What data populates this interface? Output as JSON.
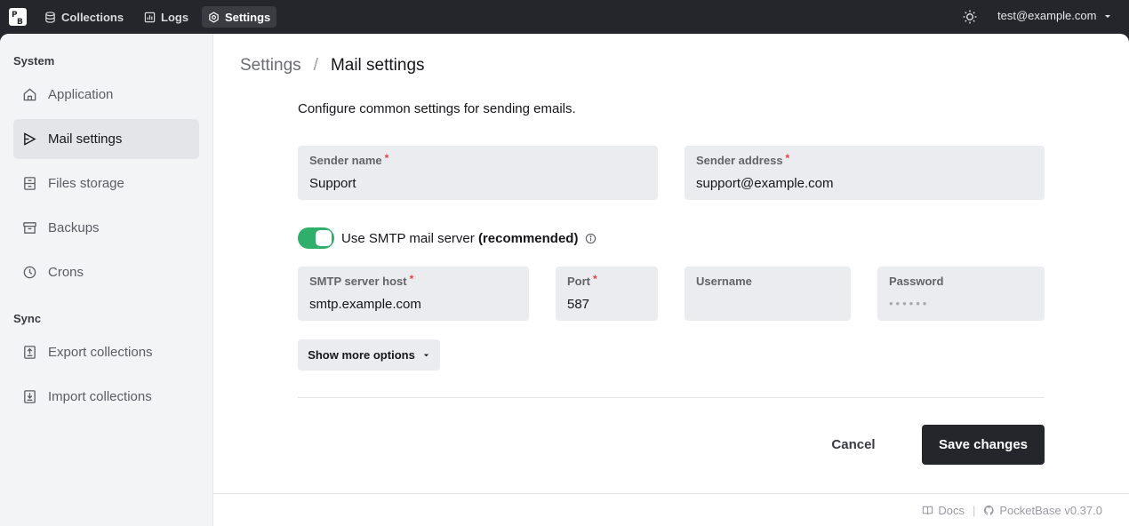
{
  "topbar": {
    "nav": [
      {
        "label": "Collections",
        "icon": "database-icon"
      },
      {
        "label": "Logs",
        "icon": "chart-icon"
      },
      {
        "label": "Settings",
        "icon": "gear-icon",
        "active": true
      }
    ],
    "user_email": "test@example.com"
  },
  "sidebar": {
    "system_title": "System",
    "sync_title": "Sync",
    "items": [
      {
        "label": "Application",
        "icon": "home-icon"
      },
      {
        "label": "Mail settings",
        "icon": "send-icon",
        "active": true
      },
      {
        "label": "Files storage",
        "icon": "storage-icon"
      },
      {
        "label": "Backups",
        "icon": "archive-icon"
      },
      {
        "label": "Crons",
        "icon": "clock-icon"
      },
      {
        "label": "Export collections",
        "icon": "export-icon"
      },
      {
        "label": "Import collections",
        "icon": "import-icon"
      }
    ]
  },
  "breadcrumb": {
    "root": "Settings",
    "separator": "/",
    "current": "Mail settings"
  },
  "intro": "Configure common settings for sending emails.",
  "fields": {
    "sender_name": {
      "label": "Sender name",
      "required": "*",
      "value": "Support"
    },
    "sender_address": {
      "label": "Sender address",
      "required": "*",
      "value": "support@example.com"
    },
    "smtp_host": {
      "label": "SMTP server host",
      "required": "*",
      "value": "smtp.example.com"
    },
    "port": {
      "label": "Port",
      "required": "*",
      "value": "587"
    },
    "username": {
      "label": "Username",
      "value": ""
    },
    "password": {
      "label": "Password",
      "placeholder": "••••••"
    }
  },
  "smtp_toggle": {
    "label": "Use SMTP mail server",
    "emphasis": "(recommended)",
    "enabled": true
  },
  "buttons": {
    "show_more": "Show more options",
    "cancel": "Cancel",
    "save": "Save changes"
  },
  "footer": {
    "docs": "Docs",
    "version": "PocketBase v0.37.0"
  },
  "colors": {
    "accent_green": "#2faf6b",
    "dark": "#25262b",
    "required": "#e3414c"
  }
}
